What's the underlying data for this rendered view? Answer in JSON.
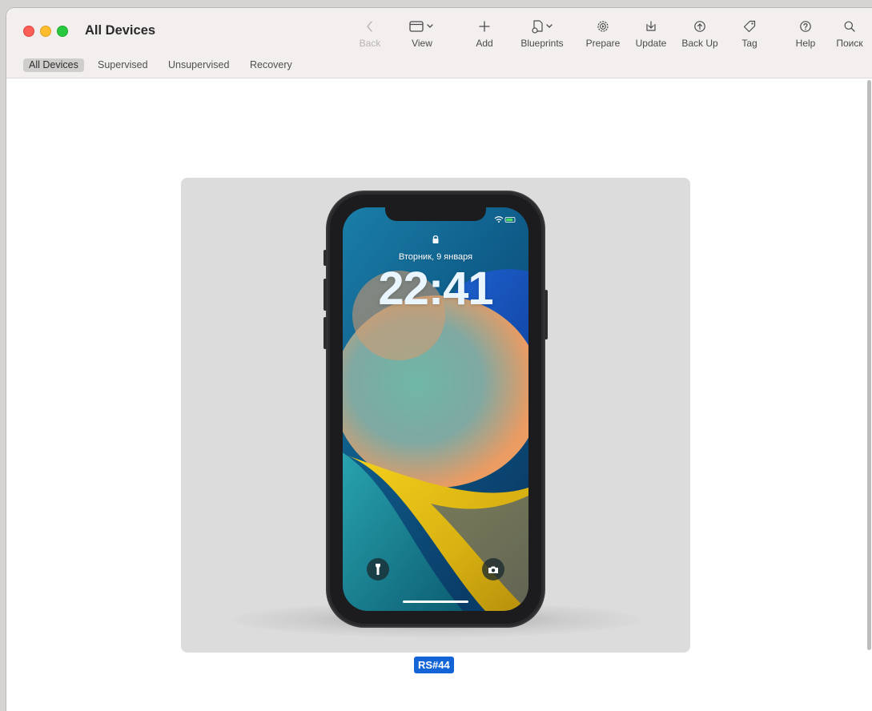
{
  "window": {
    "title": "All Devices"
  },
  "toolbar": {
    "back_label": "Back",
    "view_label": "View",
    "add_label": "Add",
    "blueprints_label": "Blueprints",
    "prepare_label": "Prepare",
    "update_label": "Update",
    "backup_label": "Back Up",
    "tag_label": "Tag",
    "help_label": "Help",
    "search_label": "Поиск"
  },
  "tabs": {
    "all": "All Devices",
    "supervised": "Supervised",
    "unsupervised": "Unsupervised",
    "recovery": "Recovery",
    "active": "All Devices"
  },
  "device": {
    "name": "RS#44",
    "lock_date": "Вторник, 9 января",
    "lock_time": "22:41"
  },
  "colors": {
    "selection": "#1364d6",
    "titlebar": "#f4efef"
  },
  "icons": {
    "back": "chevron-left-icon",
    "view": "window-icon",
    "add": "plus-icon",
    "blueprints": "blueprint-icon",
    "prepare": "gear-icon",
    "update": "download-tray-icon",
    "backup": "upload-circle-icon",
    "tag": "tag-icon",
    "help": "question-circle-icon",
    "search": "search-icon"
  }
}
